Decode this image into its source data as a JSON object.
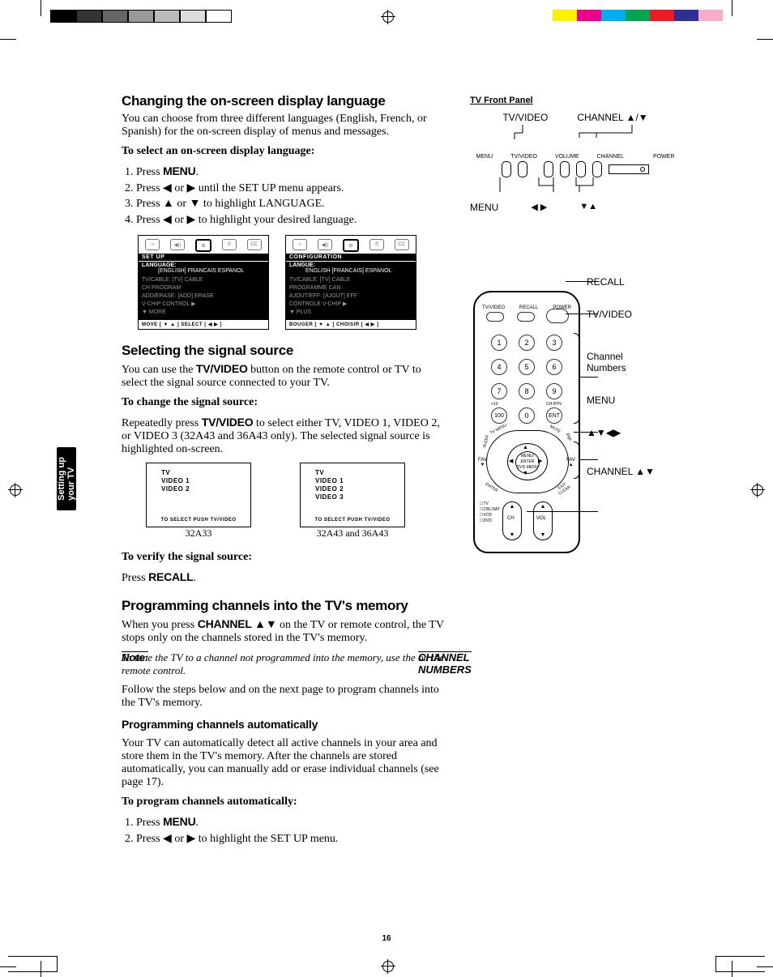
{
  "page_number": "16",
  "side_tab": "Setting up\nyour TV",
  "sections": {
    "s1": {
      "title": "Changing the on-screen display language",
      "intro": "You can choose from three different languages (English, French, or Spanish) for the on-screen display of menus and messages.",
      "lead": "To select an on-screen display language:",
      "steps": {
        "a": "Press ",
        "a_btn": "MENU",
        "a_end": ".",
        "b": "Press ◀ or ▶ until the SET UP menu appears.",
        "c": "Press ▲ or ▼ to highlight LANGUAGE.",
        "d": "Press ◀ or ▶ to highlight your desired language."
      }
    },
    "osd_en": {
      "title": "SET UP",
      "item_label": "LANGUAGE:",
      "item_vals": "[ENGLISH]  FRANCAIS  ESPANOL",
      "body1": "TV/CABLE:              [TV]  CABLE",
      "body2": "CH PROGRAM",
      "body3": "ADD/ERASE:           [ADD]  ERASE",
      "body4": "V-CHIP CONTROL   ▶",
      "body5": "▼ MORE",
      "foot": "MOVE [ ▼ ▲ ]      SELECT [ ◀  ▶ ]"
    },
    "osd_fr": {
      "title": "CONFIGURATION",
      "item_label": "LANGUE:",
      "item_vals": "ENGLISH  [FRANCAIS]  ESPANOL",
      "body1": "TV/CABLE:              [TV]  CABLE",
      "body2": "PROGRAMME CAN",
      "body3": "AJOUT/EFF:           [AJOUT]  EFF",
      "body4": "CONTROLE V-CHIP  ▶",
      "body5": "▼ PLUS",
      "foot": "BOUGER [ ▼ ▲ ]    CHOISIR [ ◀  ▶ ]"
    },
    "s2": {
      "title": "Selecting the signal source",
      "intro_a": "You can use the ",
      "intro_btn": "TV/VIDEO",
      "intro_b": " button on the remote control or TV to select the signal source connected to your TV.",
      "lead": "To change the signal source:",
      "body_a": "Repeatedly press ",
      "body_btn": "TV/VIDEO",
      "body_b": " to select either TV, VIDEO 1, VIDEO 2, or VIDEO 3 (32A43 and 36A43 only). The selected signal source is highlighted on-screen.",
      "sig1": {
        "l1": "TV",
        "l2": "VIDEO 1",
        "l3": "VIDEO 2",
        "l4": "",
        "foot": "TO SELECT PUSH TV/VIDEO",
        "cap": "32A33"
      },
      "sig2": {
        "l1": "TV",
        "l2": "VIDEO 1",
        "l3": "VIDEO 2",
        "l4": "VIDEO 3",
        "foot": "TO SELECT PUSH TV/VIDEO",
        "cap": "32A43 and 36A43"
      },
      "verify_lead": "To verify the signal source:",
      "verify_a": "Press ",
      "verify_btn": "RECALL",
      "verify_end": "."
    },
    "s3": {
      "title": "Programming channels into the TV's memory",
      "intro_a": "When you press ",
      "intro_btn": "CHANNEL ▲▼",
      "intro_b": " on the TV or remote control, the TV stops only on the channels stored in the TV's memory.",
      "note_lead": "Note:",
      "note_a": " To tune the TV to a channel not programmed into the memory, use the ",
      "note_btn": "CHANNEL NUMBERS",
      "note_b": " on the remote control.",
      "follow": "Follow the steps below and on the next page to program channels into the TV's memory.",
      "sub": "Programming channels automatically",
      "auto_body": "Your TV can automatically detect all active channels in your area and store them in the TV's memory. After the channels are stored automatically, you can manually add or erase individual channels (see page 17).",
      "prog_lead": "To program channels automatically:",
      "st1_a": "Press ",
      "st1_btn": "MENU",
      "st1_end": ".",
      "st2": "Press ◀ or ▶ to highlight the SET UP menu."
    }
  },
  "right": {
    "fp_title": "TV Front Panel",
    "fp_tvvideo": "TV/VIDEO",
    "fp_channel": "CHANNEL ▲/▼",
    "fp_labels": {
      "menu": "MENU",
      "tvv": "TV/VIDEO",
      "vol": "VOLUME",
      "chan": "CHANNEL",
      "pwr": "POWER"
    },
    "fp_menu": "MENU",
    "fp_lr": "◀ ▶",
    "fp_ud": "▼▲",
    "callouts": {
      "recall": "RECALL",
      "tvvideo": "TV/VIDEO",
      "nums": "Channel\nNumbers",
      "menu": "MENU",
      "arrows": "▲▼◀▶",
      "chan": "CHANNEL ▲▼"
    },
    "remote_labels": {
      "tvv": "TV/VIDEO",
      "rec": "RECALL",
      "pwr": "POWER",
      "n1": "1",
      "n2": "2",
      "n3": "3",
      "n4": "4",
      "n5": "5",
      "n6": "6",
      "n7": "7",
      "n8": "8",
      "n9": "9",
      "n10": "+10",
      "n0": "0",
      "ent": "ENT",
      "ch100": "100",
      "chrtn": "CH RTN",
      "tvmenu": "TV MENU",
      "sleep": "SLEEP",
      "mute": "MUTE",
      "pip": "PIP",
      "menu": "MENU/\nENTER\nDVD MENU",
      "fav": "FAV\n▼",
      "fav2": "FAV\n▲",
      "enter": "ENTER",
      "exit": "EXIT\nCLEAR",
      "ch": "CH",
      "vol": "VOL",
      "tv": "TV",
      "cbl": "CBL/SAT",
      "vcr": "VCR",
      "dvd": "DVD"
    }
  },
  "colors": {
    "c1": "#000000",
    "c2": "#333333",
    "c3": "#666666",
    "c4": "#999999",
    "c5": "#cccccc",
    "c6": "#ffffff",
    "y": "#fff200",
    "m": "#ec008c",
    "c": "#00aeef",
    "g": "#00a651",
    "r": "#ed1c24",
    "p": "#f7adc9",
    "b": "#2e3192"
  }
}
